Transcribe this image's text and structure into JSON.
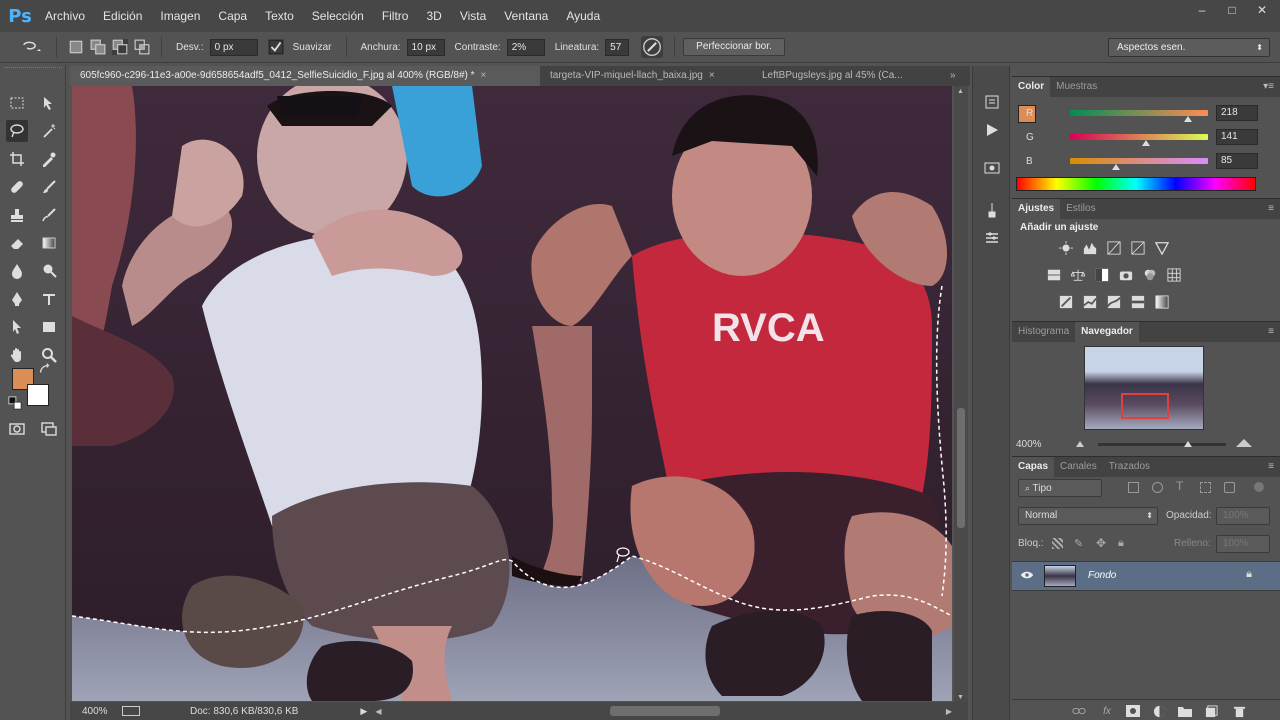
{
  "app": {
    "logo": "Ps"
  },
  "menu": [
    "Archivo",
    "Edición",
    "Imagen",
    "Capa",
    "Texto",
    "Selección",
    "Filtro",
    "3D",
    "Vista",
    "Ventana",
    "Ayuda"
  ],
  "window_controls": {
    "minimize": "–",
    "maximize": "□",
    "close": "✕"
  },
  "options": {
    "feather_label": "Desv.:",
    "feather_value": "0 px",
    "smooth_label": "Suavizar",
    "width_label": "Anchura:",
    "width_value": "10 px",
    "contrast_label": "Contraste:",
    "contrast_value": "2%",
    "frequency_label": "Lineatura:",
    "frequency_value": "57",
    "refine_button": "Perfeccionar bor.",
    "workspace": "Aspectos esen."
  },
  "tabs": [
    {
      "label": "605fc960-c296-11e3-a00e-9d658654adf5_0412_SelfieSuicidio_F.jpg al 400% (RGB/8#) *",
      "active": true
    },
    {
      "label": "targeta-VIP-miquel-llach_baixa.jpg",
      "active": false
    },
    {
      "label": "LeftBPugsleys.jpg al 45% (Ca...",
      "active": false
    }
  ],
  "tabs_overflow": "»",
  "status": {
    "zoom": "400%",
    "doc": "Doc: 830,6 KB/830,6 KB"
  },
  "color_panel": {
    "tabs": [
      "Color",
      "Muestras"
    ],
    "r_label": "R",
    "r_value": "218",
    "r": 218,
    "g_label": "G",
    "g_value": "141",
    "g": 141,
    "b_label": "B",
    "b_value": "85",
    "b": 85,
    "foreground": "#da8d55",
    "background": "#ffffff"
  },
  "adjust_panel": {
    "tabs": [
      "Ajustes",
      "Estilos"
    ],
    "heading": "Añadir un ajuste"
  },
  "navigator_panel": {
    "tabs": [
      "Histograma",
      "Navegador"
    ],
    "zoom": "400%"
  },
  "layers_panel": {
    "tabs": [
      "Capas",
      "Canales",
      "Trazados"
    ],
    "filter": "Tipo",
    "blend_mode": "Normal",
    "opacity_label": "Opacidad:",
    "opacity_value": "100%",
    "lock_label": "Bloq.:",
    "fill_label": "Relleno:",
    "fill_value": "100%",
    "layers": [
      {
        "name": "Fondo",
        "visible": true,
        "locked": true
      }
    ]
  }
}
